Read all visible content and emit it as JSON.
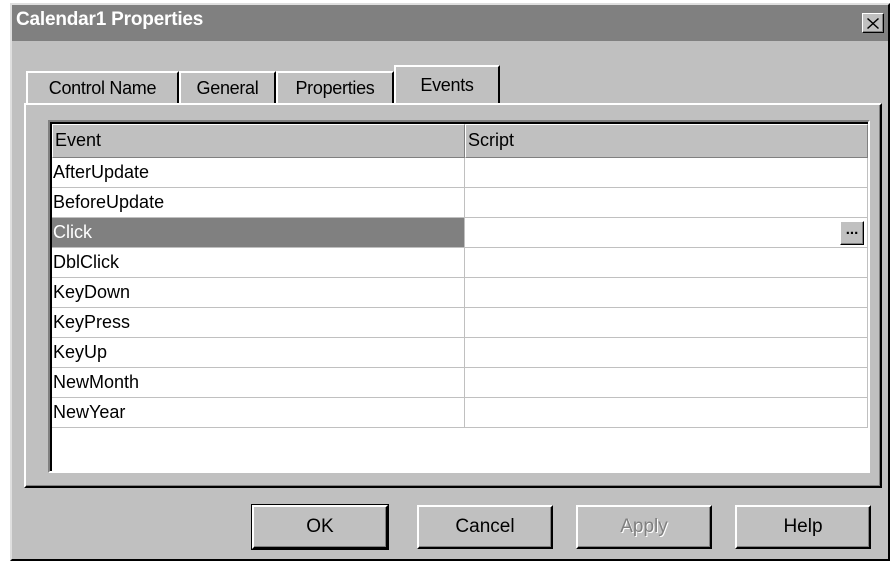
{
  "window": {
    "title": "Calendar1 Properties",
    "close_label": "×"
  },
  "tabs": [
    {
      "label": "Control Name",
      "active": false
    },
    {
      "label": "General",
      "active": false
    },
    {
      "label": "Properties",
      "active": false
    },
    {
      "label": "Events",
      "active": true
    }
  ],
  "grid": {
    "columns": [
      "Event",
      "Script"
    ],
    "rows": [
      {
        "event": "AfterUpdate",
        "script": ""
      },
      {
        "event": "BeforeUpdate",
        "script": ""
      },
      {
        "event": "Click",
        "script": "",
        "selected": true
      },
      {
        "event": "DblClick",
        "script": ""
      },
      {
        "event": "KeyDown",
        "script": ""
      },
      {
        "event": "KeyPress",
        "script": ""
      },
      {
        "event": "KeyUp",
        "script": ""
      },
      {
        "event": "NewMonth",
        "script": ""
      },
      {
        "event": "NewYear",
        "script": ""
      }
    ],
    "ellipsis_label": "..."
  },
  "buttons": {
    "ok": "OK",
    "cancel": "Cancel",
    "apply": "Apply",
    "help": "Help"
  },
  "colors": {
    "face": "#c0c0c0",
    "titlebar": "#808080",
    "selection": "#808080"
  }
}
